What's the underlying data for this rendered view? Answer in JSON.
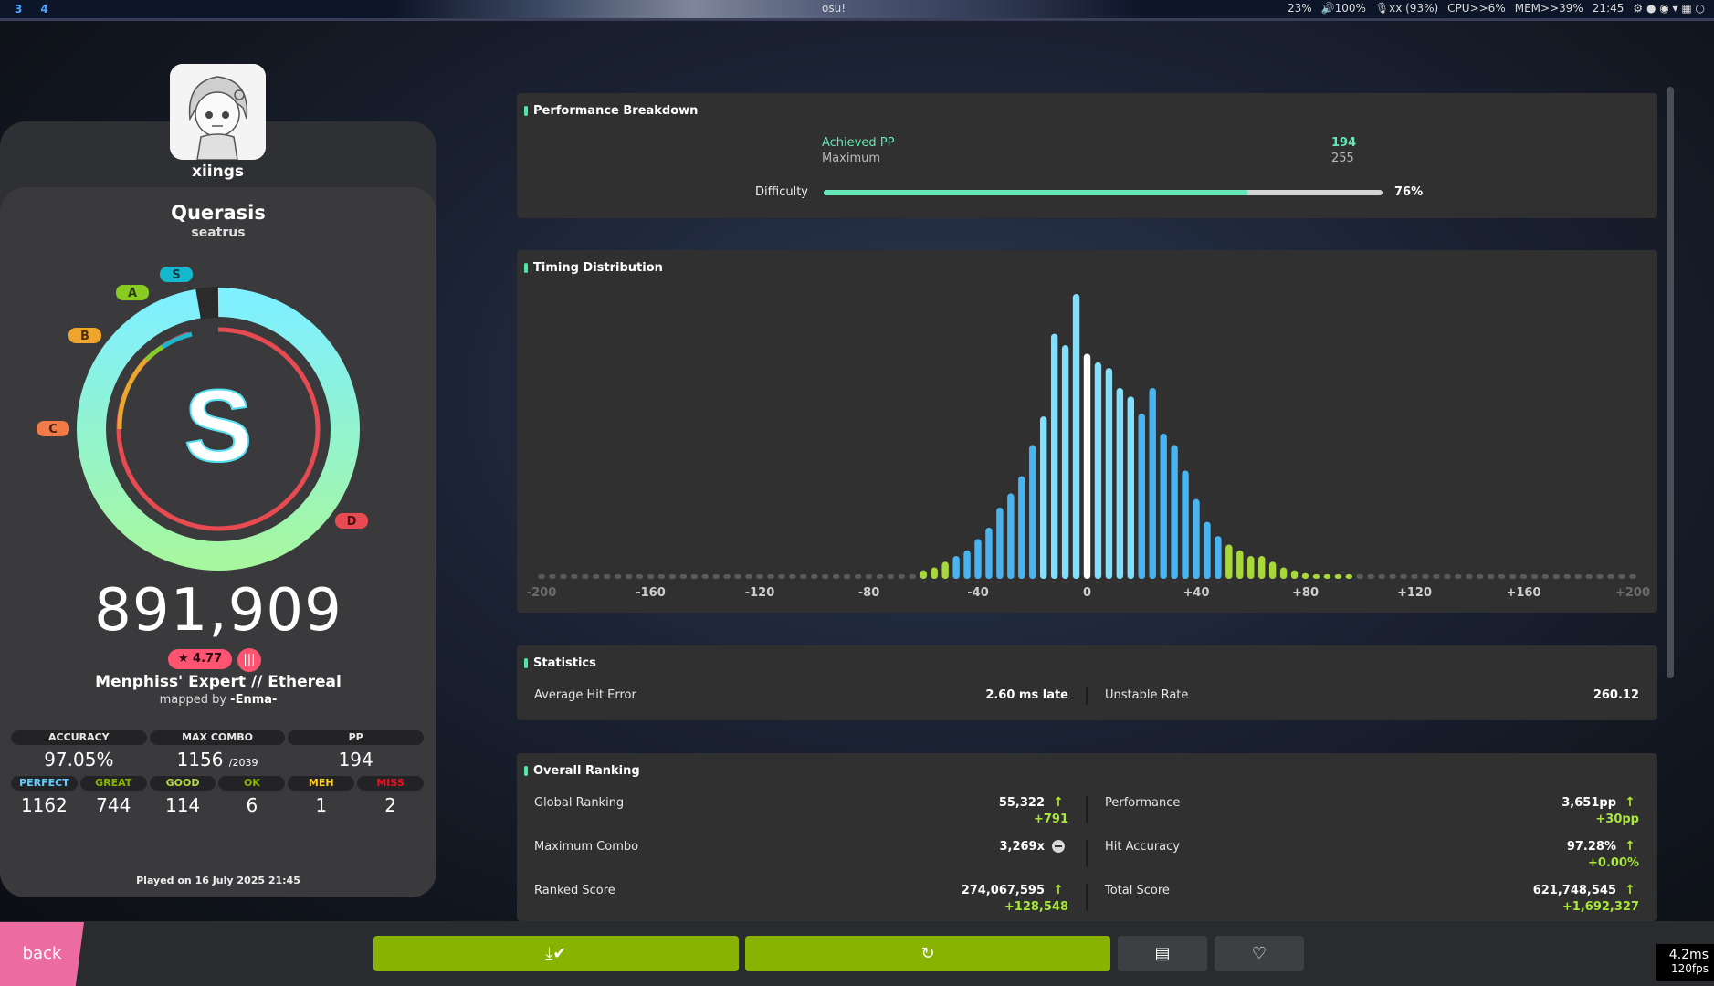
{
  "system_bar": {
    "workspaces": [
      "3",
      "4"
    ],
    "window_title": "osu!",
    "brightness": "23%",
    "volume": "100%",
    "mic": "xx (93%)",
    "cpu": "CPU>>6%",
    "mem": "MEM>>39%",
    "clock": "21:45"
  },
  "player": {
    "username": "xiings"
  },
  "beatmap": {
    "title": "Querasis",
    "artist": "seatrus",
    "star_rating": "★ 4.77",
    "difficulty_name": "Menphiss' Expert // Ethereal",
    "mapped_by_prefix": "mapped by",
    "mapper": "-Enma-"
  },
  "result": {
    "grade": "S",
    "score": "891,909",
    "rank_badges": [
      "S",
      "A",
      "B",
      "C",
      "D"
    ],
    "accuracy_fraction": 0.9705,
    "played_on": "Played on 16 July 2025 21:45"
  },
  "stats_top": [
    {
      "label": "ACCURACY",
      "value": "97.05%",
      "sub": ""
    },
    {
      "label": "MAX COMBO",
      "value": "1156",
      "sub": "/2039"
    },
    {
      "label": "PP",
      "value": "194",
      "sub": ""
    }
  ],
  "hit_counts": [
    {
      "label": "PERFECT",
      "value": "1162",
      "color": "#66ccff"
    },
    {
      "label": "GREAT",
      "value": "744",
      "color": "#88b300"
    },
    {
      "label": "GOOD",
      "value": "114",
      "color": "#b3d944"
    },
    {
      "label": "OK",
      "value": "6",
      "color": "#88b300"
    },
    {
      "label": "MEH",
      "value": "1",
      "color": "#ffcc22"
    },
    {
      "label": "MISS",
      "value": "2",
      "color": "#ed1121"
    }
  ],
  "performance": {
    "title": "Performance Breakdown",
    "achieved_label": "Achieved PP",
    "achieved_value": "194",
    "maximum_label": "Maximum",
    "maximum_value": "255",
    "difficulty_label": "Difficulty",
    "difficulty_percent": "76%",
    "difficulty_fraction": 0.76
  },
  "timing": {
    "title": "Timing Distribution"
  },
  "chart_data": {
    "type": "bar",
    "title": "Timing Distribution",
    "x_tick_labels": [
      "-200",
      "-160",
      "-120",
      "-80",
      "-40",
      "0",
      "+40",
      "+80",
      "+120",
      "+160",
      "+200"
    ],
    "x_ticks": [
      -200,
      -160,
      -120,
      -80,
      -40,
      0,
      40,
      80,
      120,
      160,
      200
    ],
    "xlim": [
      -200,
      200
    ],
    "ylim": [
      0,
      100
    ],
    "bin_width": 4,
    "bins": [
      {
        "x": -60,
        "v": 3
      },
      {
        "x": -56,
        "v": 4
      },
      {
        "x": -52,
        "v": 6
      },
      {
        "x": -48,
        "v": 8
      },
      {
        "x": -44,
        "v": 10
      },
      {
        "x": -40,
        "v": 14
      },
      {
        "x": -36,
        "v": 18
      },
      {
        "x": -32,
        "v": 25
      },
      {
        "x": -28,
        "v": 30
      },
      {
        "x": -24,
        "v": 36
      },
      {
        "x": -20,
        "v": 47
      },
      {
        "x": -16,
        "v": 57
      },
      {
        "x": -12,
        "v": 86
      },
      {
        "x": -8,
        "v": 82
      },
      {
        "x": -4,
        "v": 100
      },
      {
        "x": 0,
        "v": 79
      },
      {
        "x": 4,
        "v": 76
      },
      {
        "x": 8,
        "v": 74
      },
      {
        "x": 12,
        "v": 67
      },
      {
        "x": 16,
        "v": 64
      },
      {
        "x": 20,
        "v": 58
      },
      {
        "x": 24,
        "v": 67
      },
      {
        "x": 28,
        "v": 51
      },
      {
        "x": 32,
        "v": 47
      },
      {
        "x": 36,
        "v": 38
      },
      {
        "x": 40,
        "v": 28
      },
      {
        "x": 44,
        "v": 20
      },
      {
        "x": 48,
        "v": 15
      },
      {
        "x": 52,
        "v": 12
      },
      {
        "x": 56,
        "v": 10
      },
      {
        "x": 60,
        "v": 8
      },
      {
        "x": 64,
        "v": 8
      },
      {
        "x": 68,
        "v": 6
      },
      {
        "x": 72,
        "v": 4
      },
      {
        "x": 76,
        "v": 3
      },
      {
        "x": 80,
        "v": 2
      },
      {
        "x": 84,
        "v": 1
      },
      {
        "x": 88,
        "v": 1
      },
      {
        "x": 92,
        "v": 1
      },
      {
        "x": 96,
        "v": 1
      }
    ]
  },
  "statistics": {
    "title": "Statistics",
    "avg_hit_error_label": "Average Hit Error",
    "avg_hit_error_value": "2.60 ms late",
    "unstable_rate_label": "Unstable Rate",
    "unstable_rate_value": "260.12"
  },
  "overall_ranking": {
    "title": "Overall Ranking",
    "global_ranking_label": "Global Ranking",
    "global_ranking_value": "55,322",
    "global_ranking_delta": "+791",
    "performance_label": "Performance",
    "performance_value": "3,651pp",
    "performance_delta": "+30pp",
    "max_combo_label": "Maximum Combo",
    "max_combo_value": "3,269x",
    "hit_accuracy_label": "Hit Accuracy",
    "hit_accuracy_value": "97.28%",
    "hit_accuracy_delta": "+0.00%",
    "ranked_score_label": "Ranked Score",
    "ranked_score_value": "274,067,595",
    "ranked_score_delta": "+128,548",
    "total_score_label": "Total Score",
    "total_score_value": "621,748,545",
    "total_score_delta": "+1,692,327"
  },
  "bottom_bar": {
    "back_label": "back",
    "download_icon": "download-check-icon",
    "retry_icon": "retry-icon",
    "notes_icon": "notes-icon",
    "favourite_icon": "heart-icon",
    "frame_time": "4.2ms",
    "fps": "120fps"
  },
  "colors": {
    "accent_green": "#50e6a8",
    "button_green": "#88b300",
    "back_pink": "#ec6ba0",
    "star_pink": "#ff5471",
    "bar_light": "#7fe0ff",
    "bar_dark": "#4ab4f0",
    "bar_lime": "#a8d83c"
  }
}
